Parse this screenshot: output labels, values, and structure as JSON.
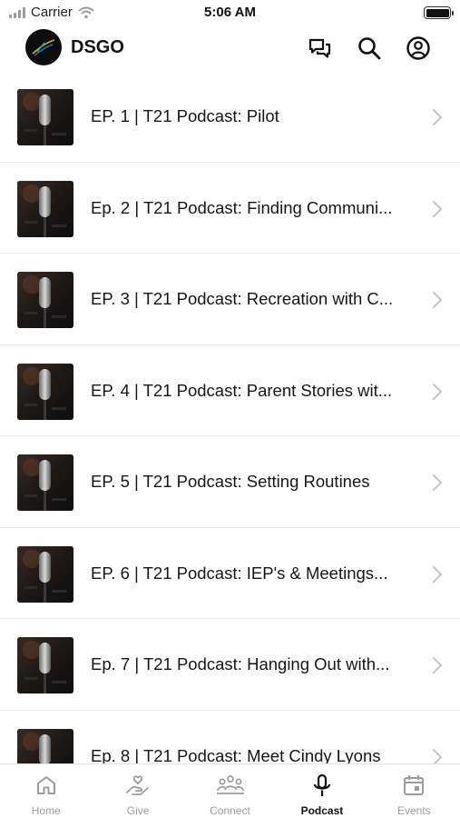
{
  "status": {
    "carrier": "Carrier",
    "time": "5:06 AM"
  },
  "header": {
    "title": "DSGO",
    "icons": [
      "chat-icon",
      "search-icon",
      "profile-icon"
    ]
  },
  "episodes": [
    {
      "title": "EP. 1 | T21 Podcast: Pilot"
    },
    {
      "title": "Ep. 2 | T21 Podcast: Finding Communi..."
    },
    {
      "title": "EP. 3 | T21 Podcast: Recreation with C..."
    },
    {
      "title": "EP. 4 | T21 Podcast: Parent Stories wit..."
    },
    {
      "title": "EP. 5 | T21 Podcast: Setting Routines"
    },
    {
      "title": "EP. 6 | T21 Podcast: IEP's & Meetings..."
    },
    {
      "title": "Ep. 7 | T21 Podcast: Hanging Out with..."
    },
    {
      "title": "Ep. 8 | T21 Podcast: Meet Cindy Lyons"
    }
  ],
  "tabs": [
    {
      "label": "Home",
      "icon": "home-icon",
      "active": false
    },
    {
      "label": "Give",
      "icon": "give-icon",
      "active": false
    },
    {
      "label": "Connect",
      "icon": "connect-icon",
      "active": false
    },
    {
      "label": "Podcast",
      "icon": "microphone-icon",
      "active": true
    },
    {
      "label": "Events",
      "icon": "calendar-icon",
      "active": false
    }
  ],
  "colors": {
    "active_tab": "#111111",
    "inactive_tab": "#9c9c9c",
    "divider": "#e9e9e9"
  }
}
